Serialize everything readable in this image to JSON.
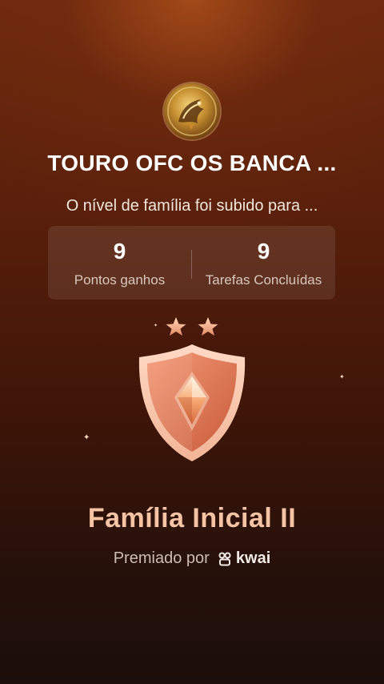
{
  "header": {
    "group_name": "TOURO OFC OS BANCA ...",
    "level_message": "O nível de família foi subido para ..."
  },
  "stats": [
    {
      "value": "9",
      "label": "Pontos ganhos"
    },
    {
      "value": "9",
      "label": "Tarefas Concluídas"
    }
  ],
  "badge": {
    "title": "Família Inicial II",
    "stars": 2,
    "icon": "shield-diamond-badge-icon"
  },
  "footer": {
    "awarded_by_label": "Premiado por",
    "brand": "kwai"
  },
  "colors": {
    "background_top": "#6e2a0e",
    "background_bottom": "#1c0e0a",
    "title_accent": "#f6c3a5",
    "badge_main": "#e8896a"
  }
}
